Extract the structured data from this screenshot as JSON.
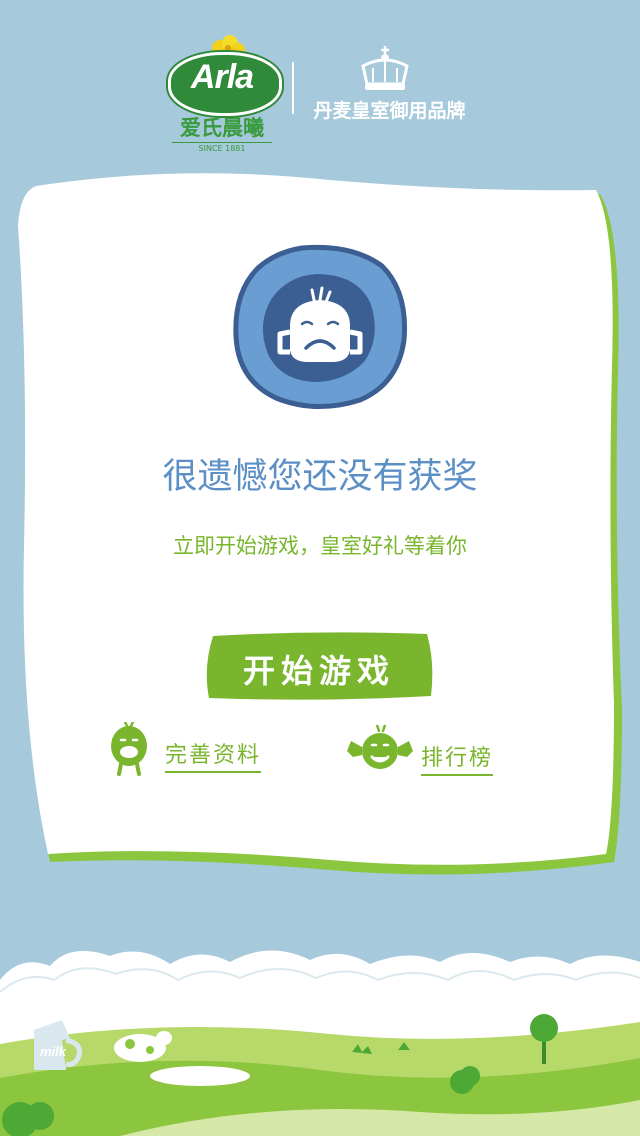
{
  "header": {
    "brand_name": "Arla",
    "brand_cn": "爱氏晨曦",
    "brand_since": "SINCE 1881",
    "royal_text": "丹麦皇室御用品牌"
  },
  "result": {
    "headline": "很遗憾您还没有获奖",
    "subline": "立即开始游戏，皇室好礼等着你"
  },
  "actions": {
    "start_game": "开始游戏",
    "complete_profile": "完善资料",
    "leaderboard": "排行榜"
  },
  "scene": {
    "milk_label": "milk"
  },
  "colors": {
    "background": "#a6c9dc",
    "accent_green": "#79b62d",
    "headline_blue": "#5b8fc6",
    "badge_blue": "#4f79b8"
  }
}
